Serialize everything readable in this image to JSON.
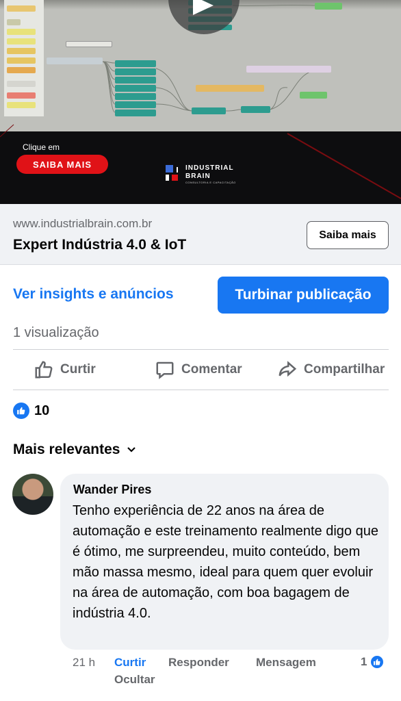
{
  "ad_video": {
    "cta_prefix": "Clique em",
    "cta_button": "SAIBA MAIS",
    "brand_line1": "INDUSTRIAL",
    "brand_line2": "BRAIN",
    "brand_tagline": "CONSULTORIA E CAPACITAÇÃO",
    "play_icon": "play-icon"
  },
  "link_card": {
    "url": "www.industrialbrain.com.br",
    "title": "Expert Indústria 4.0 & IoT",
    "button": "Saiba mais"
  },
  "actions": {
    "insights_link": "Ver insights e anúncios",
    "boost_button": "Turbinar publicação",
    "views": "1 visualização"
  },
  "reaction_bar": {
    "like": "Curtir",
    "comment": "Comentar",
    "share": "Compartilhar"
  },
  "reactions": {
    "like_count": "10"
  },
  "comments_filter": {
    "label": "Mais relevantes"
  },
  "comment": {
    "author": "Wander Pires",
    "text": "Tenho experiência de 22 anos na área de automação e este  treinamento realmente digo que é ótimo, me surpreendeu, muito conteúdo, bem mão massa mesmo, ideal para quem quer evoluir na área de automação, com boa bagagem de indústria 4.0.",
    "time": "21 h",
    "like": "Curtir",
    "reply": "Responder",
    "message": "Mensagem",
    "hide": "Ocultar",
    "like_count": "1"
  },
  "colors": {
    "facebook_blue": "#1877f2",
    "cta_red": "#e01217",
    "muted_text": "#65676b",
    "card_bg": "#f0f2f5"
  }
}
